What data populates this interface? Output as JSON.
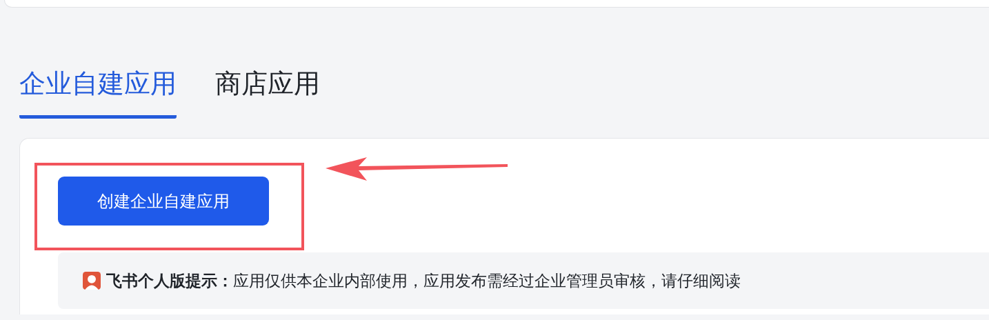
{
  "tabs": [
    {
      "label": "企业自建应用",
      "selected": true
    },
    {
      "label": "商店应用",
      "selected": false
    }
  ],
  "create_button": {
    "label": "创建企业自建应用"
  },
  "notice": {
    "text": "**飞书个人版提示：**应用仅供本企业内部使用，应用发布需经过企业管理员审核，请仔细阅读"
  }
}
